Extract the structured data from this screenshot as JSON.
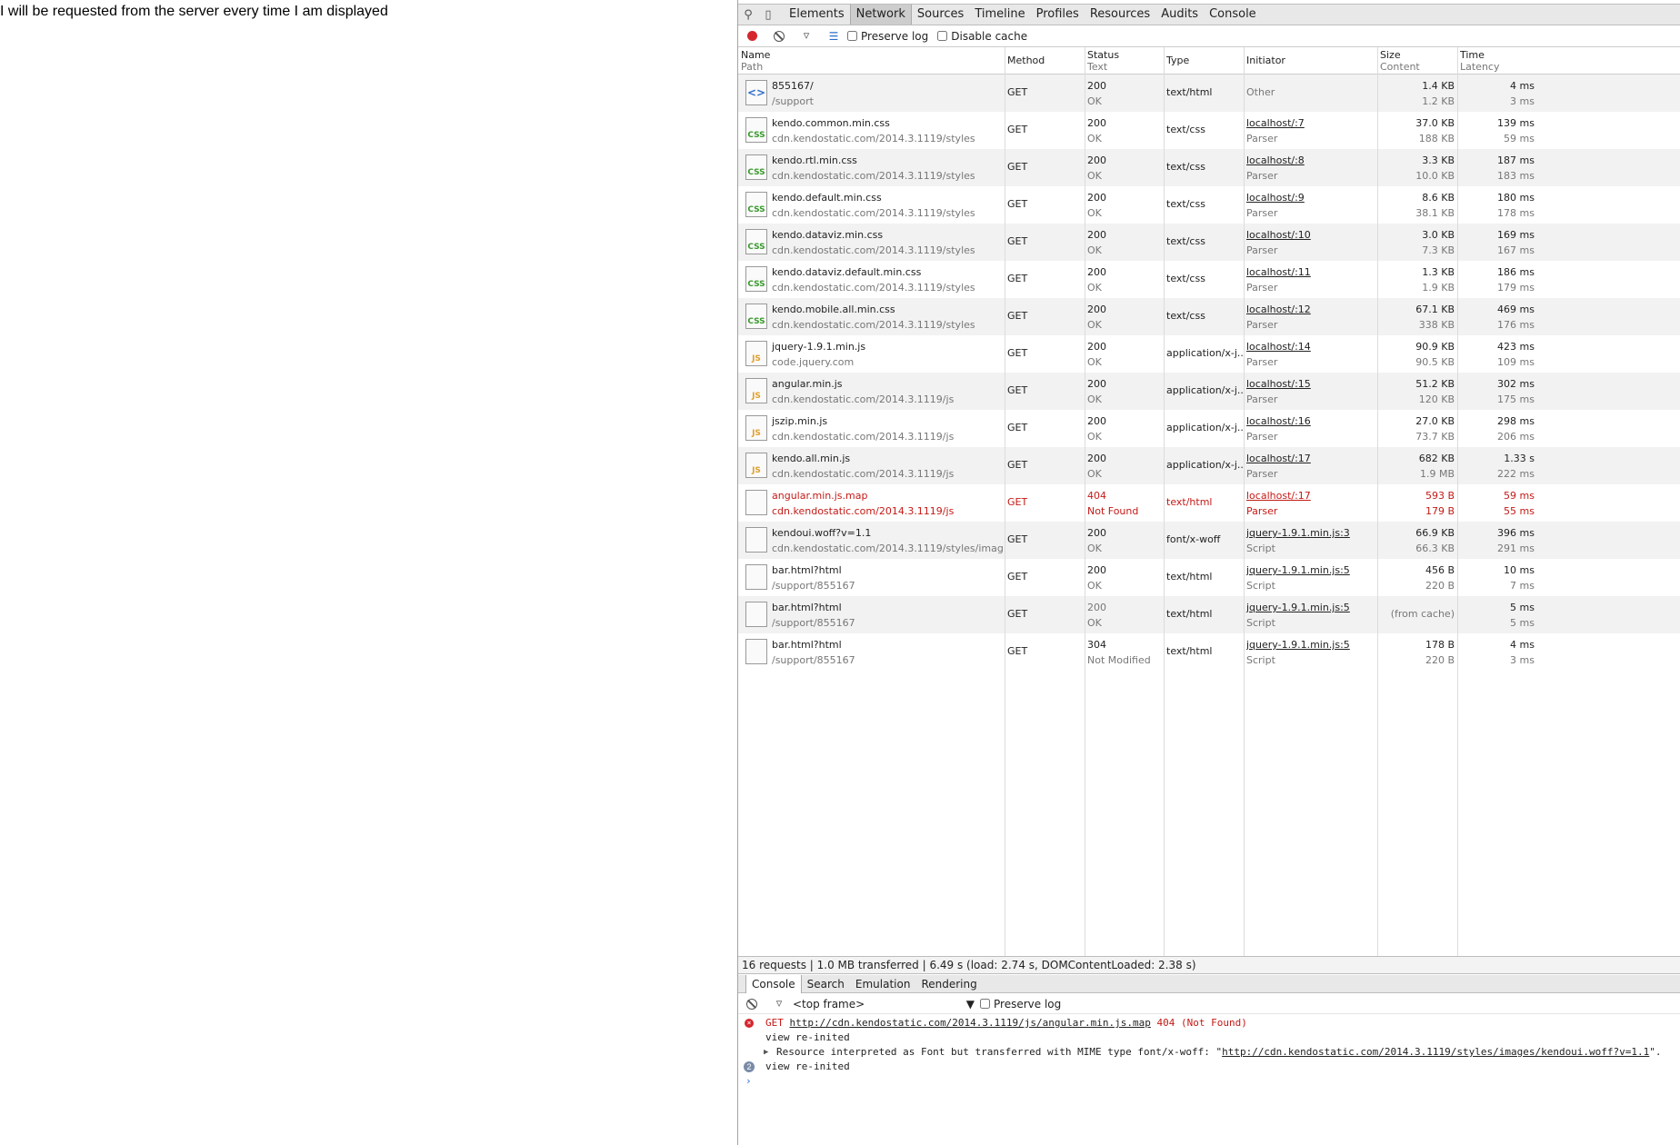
{
  "page": {
    "text": "I will be requested from the server every time I am displayed"
  },
  "devtools": {
    "tabs": [
      {
        "label": "Elements"
      },
      {
        "label": "Network",
        "selected": true
      },
      {
        "label": "Sources"
      },
      {
        "label": "Timeline"
      },
      {
        "label": "Profiles"
      },
      {
        "label": "Resources"
      },
      {
        "label": "Audits"
      },
      {
        "label": "Console"
      }
    ],
    "toolbar": {
      "preserve_log": "Preserve log",
      "disable_cache": "Disable cache"
    },
    "columns": {
      "name": "Name",
      "path": "Path",
      "method": "Method",
      "status": "Status",
      "text": "Text",
      "type": "Type",
      "initiator": "Initiator",
      "size": "Size",
      "content": "Content",
      "time": "Time",
      "latency": "Latency"
    },
    "requests": [
      {
        "icon": "html",
        "name": "855167/",
        "path": "/support",
        "method": "GET",
        "status": "200",
        "status_text": "OK",
        "type": "text/html",
        "initiator": "Other",
        "initiator_sub": "",
        "size": "1.4 KB",
        "content": "1.2 KB",
        "time": "4 ms",
        "latency": "3 ms"
      },
      {
        "icon": "css",
        "name": "kendo.common.min.css",
        "path": "cdn.kendostatic.com/2014.3.1119/styles",
        "method": "GET",
        "status": "200",
        "status_text": "OK",
        "type": "text/css",
        "initiator": "localhost/:7",
        "initiator_sub": "Parser",
        "size": "37.0 KB",
        "content": "188 KB",
        "time": "139 ms",
        "latency": "59 ms"
      },
      {
        "icon": "css",
        "name": "kendo.rtl.min.css",
        "path": "cdn.kendostatic.com/2014.3.1119/styles",
        "method": "GET",
        "status": "200",
        "status_text": "OK",
        "type": "text/css",
        "initiator": "localhost/:8",
        "initiator_sub": "Parser",
        "size": "3.3 KB",
        "content": "10.0 KB",
        "time": "187 ms",
        "latency": "183 ms"
      },
      {
        "icon": "css",
        "name": "kendo.default.min.css",
        "path": "cdn.kendostatic.com/2014.3.1119/styles",
        "method": "GET",
        "status": "200",
        "status_text": "OK",
        "type": "text/css",
        "initiator": "localhost/:9",
        "initiator_sub": "Parser",
        "size": "8.6 KB",
        "content": "38.1 KB",
        "time": "180 ms",
        "latency": "178 ms"
      },
      {
        "icon": "css",
        "name": "kendo.dataviz.min.css",
        "path": "cdn.kendostatic.com/2014.3.1119/styles",
        "method": "GET",
        "status": "200",
        "status_text": "OK",
        "type": "text/css",
        "initiator": "localhost/:10",
        "initiator_sub": "Parser",
        "size": "3.0 KB",
        "content": "7.3 KB",
        "time": "169 ms",
        "latency": "167 ms"
      },
      {
        "icon": "css",
        "name": "kendo.dataviz.default.min.css",
        "path": "cdn.kendostatic.com/2014.3.1119/styles",
        "method": "GET",
        "status": "200",
        "status_text": "OK",
        "type": "text/css",
        "initiator": "localhost/:11",
        "initiator_sub": "Parser",
        "size": "1.3 KB",
        "content": "1.9 KB",
        "time": "186 ms",
        "latency": "179 ms"
      },
      {
        "icon": "css",
        "name": "kendo.mobile.all.min.css",
        "path": "cdn.kendostatic.com/2014.3.1119/styles",
        "method": "GET",
        "status": "200",
        "status_text": "OK",
        "type": "text/css",
        "initiator": "localhost/:12",
        "initiator_sub": "Parser",
        "size": "67.1 KB",
        "content": "338 KB",
        "time": "469 ms",
        "latency": "176 ms"
      },
      {
        "icon": "js",
        "name": "jquery-1.9.1.min.js",
        "path": "code.jquery.com",
        "method": "GET",
        "status": "200",
        "status_text": "OK",
        "type": "application/x-j...",
        "initiator": "localhost/:14",
        "initiator_sub": "Parser",
        "size": "90.9 KB",
        "content": "90.5 KB",
        "time": "423 ms",
        "latency": "109 ms"
      },
      {
        "icon": "js",
        "name": "angular.min.js",
        "path": "cdn.kendostatic.com/2014.3.1119/js",
        "method": "GET",
        "status": "200",
        "status_text": "OK",
        "type": "application/x-j...",
        "initiator": "localhost/:15",
        "initiator_sub": "Parser",
        "size": "51.2 KB",
        "content": "120 KB",
        "time": "302 ms",
        "latency": "175 ms"
      },
      {
        "icon": "js",
        "name": "jszip.min.js",
        "path": "cdn.kendostatic.com/2014.3.1119/js",
        "method": "GET",
        "status": "200",
        "status_text": "OK",
        "type": "application/x-j...",
        "initiator": "localhost/:16",
        "initiator_sub": "Parser",
        "size": "27.0 KB",
        "content": "73.7 KB",
        "time": "298 ms",
        "latency": "206 ms"
      },
      {
        "icon": "js",
        "name": "kendo.all.min.js",
        "path": "cdn.kendostatic.com/2014.3.1119/js",
        "method": "GET",
        "status": "200",
        "status_text": "OK",
        "type": "application/x-j...",
        "initiator": "localhost/:17",
        "initiator_sub": "Parser",
        "size": "682 KB",
        "content": "1.9 MB",
        "time": "1.33 s",
        "latency": "222 ms"
      },
      {
        "icon": "blank",
        "name": "angular.min.js.map",
        "path": "cdn.kendostatic.com/2014.3.1119/js",
        "method": "GET",
        "status": "404",
        "status_text": "Not Found",
        "type": "text/html",
        "initiator": "localhost/:17",
        "initiator_sub": "Parser",
        "size": "593 B",
        "content": "179 B",
        "time": "59 ms",
        "latency": "55 ms",
        "error": true
      },
      {
        "icon": "blank",
        "name": "kendoui.woff?v=1.1",
        "path": "cdn.kendostatic.com/2014.3.1119/styles/images",
        "method": "GET",
        "status": "200",
        "status_text": "OK",
        "type": "font/x-woff",
        "initiator": "jquery-1.9.1.min.js:3",
        "initiator_sub": "Script",
        "size": "66.9 KB",
        "content": "66.3 KB",
        "time": "396 ms",
        "latency": "291 ms"
      },
      {
        "icon": "blank",
        "name": "bar.html?html",
        "path": "/support/855167",
        "method": "GET",
        "status": "200",
        "status_text": "OK",
        "type": "text/html",
        "initiator": "jquery-1.9.1.min.js:5",
        "initiator_sub": "Script",
        "size": "456 B",
        "content": "220 B",
        "time": "10 ms",
        "latency": "7 ms"
      },
      {
        "icon": "blank",
        "name": "bar.html?html",
        "path": "/support/855167",
        "method": "GET",
        "status": "200",
        "status_text": "OK",
        "type": "text/html",
        "initiator": "jquery-1.9.1.min.js:5",
        "initiator_sub": "Script",
        "size": "(from cache)",
        "content": "",
        "time": "5 ms",
        "latency": "5 ms",
        "cached": true
      },
      {
        "icon": "blank",
        "name": "bar.html?html",
        "path": "/support/855167",
        "method": "GET",
        "status": "304",
        "status_text": "Not Modified",
        "type": "text/html",
        "initiator": "jquery-1.9.1.min.js:5",
        "initiator_sub": "Script",
        "size": "178 B",
        "content": "220 B",
        "time": "4 ms",
        "latency": "3 ms"
      }
    ],
    "summary": "16 requests | 1.0 MB transferred | 6.49 s (load: 2.74 s, DOMContentLoaded: 2.38 s)",
    "drawer_tabs": [
      {
        "label": "Console",
        "selected": true
      },
      {
        "label": "Search"
      },
      {
        "label": "Emulation"
      },
      {
        "label": "Rendering"
      }
    ],
    "console": {
      "frame": "<top frame>",
      "preserve_log": "Preserve log",
      "messages": [
        {
          "kind": "error",
          "prefix": "GET ",
          "link": "http://cdn.kendostatic.com/2014.3.1119/js/angular.min.js.map",
          "suffix": " 404 (Not Found)"
        },
        {
          "kind": "log",
          "text": "view re-inited"
        },
        {
          "kind": "warn",
          "prefix": "Resource interpreted as Font but transferred with MIME type font/x-woff: \"",
          "link": "http://cdn.kendostatic.com/2014.3.1119/styles/images/kendoui.woff?v=1.1",
          "suffix": "\"."
        },
        {
          "kind": "count",
          "count": "2",
          "text": "view re-inited"
        }
      ],
      "prompt": "›"
    }
  }
}
